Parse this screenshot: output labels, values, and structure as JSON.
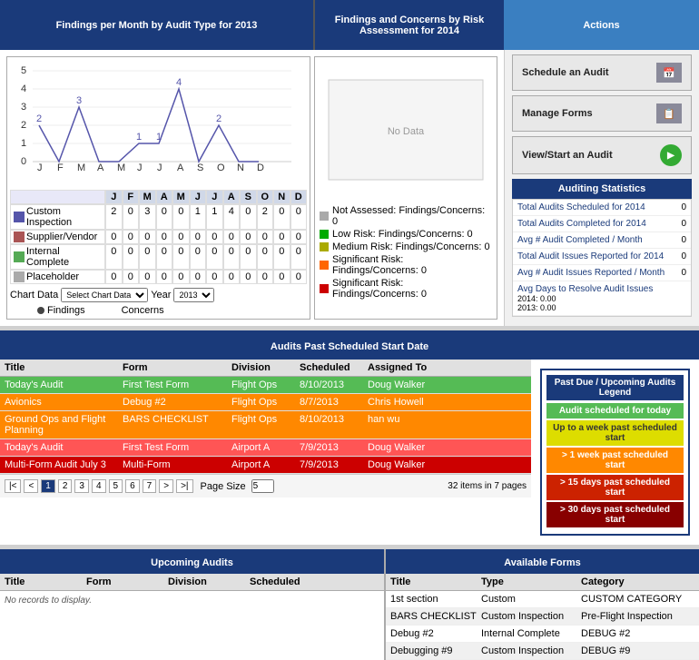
{
  "header": {
    "findings_title": "Findings per Month by Audit Type for 2013",
    "concerns_title": "Findings and Concerns by Risk Assessment for 2014",
    "actions_title": "Actions"
  },
  "actions": {
    "schedule_label": "Schedule an Audit",
    "manage_label": "Manage Forms",
    "view_label": "View/Start an Audit"
  },
  "stats": {
    "header": "Auditing Statistics",
    "rows": [
      {
        "label": "Total Audits Scheduled for 2014",
        "value": "0"
      },
      {
        "label": "Total Audits Completed for 2014",
        "value": "0"
      },
      {
        "label": "Avg # Audit Completed / Month",
        "value": "0"
      },
      {
        "label": "Total Audit Issues Reported for 2014",
        "value": "0"
      },
      {
        "label": "Avg # Audit Issues Reported / Month",
        "value": "0"
      },
      {
        "label": "Avg Days to Resolve Audit Issues",
        "value": "2014: 0.00\n2013: 0.00"
      }
    ]
  },
  "chart": {
    "data_label": "Chart Data",
    "select_placeholder": "Select Chart Data",
    "year_label": "Year",
    "year_value": "2013",
    "findings_label": "Findings",
    "concerns_label": "Concerns",
    "months": [
      "J",
      "F",
      "M",
      "A",
      "M",
      "J",
      "J",
      "A",
      "S",
      "O",
      "N",
      "D"
    ],
    "series": [
      {
        "name": "Custom Inspection",
        "color": "#5555aa",
        "values": [
          2,
          0,
          3,
          0,
          0,
          1,
          1,
          4,
          0,
          2,
          0,
          0
        ]
      },
      {
        "name": "Supplier/Vendor",
        "color": "#aa5555",
        "values": [
          0,
          0,
          0,
          0,
          0,
          0,
          0,
          0,
          0,
          0,
          0,
          0
        ]
      },
      {
        "name": "Internal Complete",
        "color": "#55aa55",
        "values": [
          0,
          0,
          0,
          0,
          0,
          0,
          0,
          0,
          0,
          0,
          0,
          0
        ]
      },
      {
        "name": "Placeholder",
        "color": "#aaaaaa",
        "values": [
          0,
          0,
          0,
          0,
          0,
          0,
          0,
          0,
          0,
          0,
          0,
          0
        ]
      }
    ]
  },
  "concerns": {
    "legend": [
      {
        "label": "Not Assessed: Findings/Concerns: 0",
        "color": "gray"
      },
      {
        "label": "Low Risk:  Findings/Concerns: 0",
        "color": "green"
      },
      {
        "label": "Medium Risk: Findings/Concerns: 0",
        "color": "yellow"
      },
      {
        "label": "Significant Risk: Findings/Concerns: 0",
        "color": "orange"
      },
      {
        "label": "Significant Risk: Findings/Concerns: 0",
        "color": "red"
      }
    ]
  },
  "audits_past": {
    "section_title": "Audits Past Scheduled Start Date",
    "columns": [
      "Title",
      "Form",
      "Division",
      "Scheduled",
      "Assigned To"
    ],
    "rows": [
      {
        "title": "Today's Audit",
        "form": "First Test Form",
        "division": "Flight Ops",
        "scheduled": "8/10/2013",
        "assigned": "Doug Walker",
        "color": "green"
      },
      {
        "title": "Avionics",
        "form": "Debug #2",
        "division": "Flight Ops",
        "scheduled": "8/7/2013",
        "assigned": "Chris Howell",
        "color": "orange"
      },
      {
        "title": "Ground Ops and Flight Planning",
        "form": "BARS CHECKLIST",
        "division": "Flight Ops",
        "scheduled": "8/10/2013",
        "assigned": "han wu",
        "color": "orange"
      },
      {
        "title": "Today's Audit",
        "form": "First Test Form",
        "division": "Airport A",
        "scheduled": "7/9/2013",
        "assigned": "Doug Walker",
        "color": "red"
      },
      {
        "title": "Multi-Form Audit July 3",
        "form": "Multi-Form",
        "division": "Airport A",
        "scheduled": "7/9/2013",
        "assigned": "Doug Walker",
        "color": "dark-red"
      }
    ],
    "page_size_label": "Page Size",
    "page_size": "5",
    "total_info": "32 items in 7 pages",
    "pages": [
      "1",
      "2",
      "3",
      "4",
      "5",
      "6",
      "7"
    ]
  },
  "past_due_legend": {
    "header": "Past Due / Upcoming Audits Legend",
    "items": [
      {
        "label": "Audit scheduled for today",
        "color": "green"
      },
      {
        "label": "Up to a week past scheduled start",
        "color": "yellow"
      },
      {
        "label": "> 1 week past scheduled start",
        "color": "orange"
      },
      {
        "label": "> 15 days past scheduled start",
        "color": "red"
      },
      {
        "label": "> 30 days past scheduled start",
        "color": "darkred"
      }
    ]
  },
  "upcoming": {
    "title": "Upcoming Audits",
    "columns": [
      "Title",
      "Form",
      "Division",
      "Scheduled"
    ],
    "no_records": "No records to display."
  },
  "available_forms": {
    "title": "Available Forms",
    "columns": [
      "Title",
      "Type",
      "Category"
    ],
    "rows": [
      {
        "title": "1st section",
        "type": "Custom",
        "category": "CUSTOM CATEGORY"
      },
      {
        "title": "BARS CHECKLIST",
        "type": "Custom Inspection",
        "category": "Pre-Flight Inspection"
      },
      {
        "title": "Debug #2",
        "type": "Internal Complete",
        "category": "DEBUG #2"
      },
      {
        "title": "Debugging #9",
        "type": "Custom Inspection",
        "category": "DEBUG #9"
      }
    ]
  }
}
